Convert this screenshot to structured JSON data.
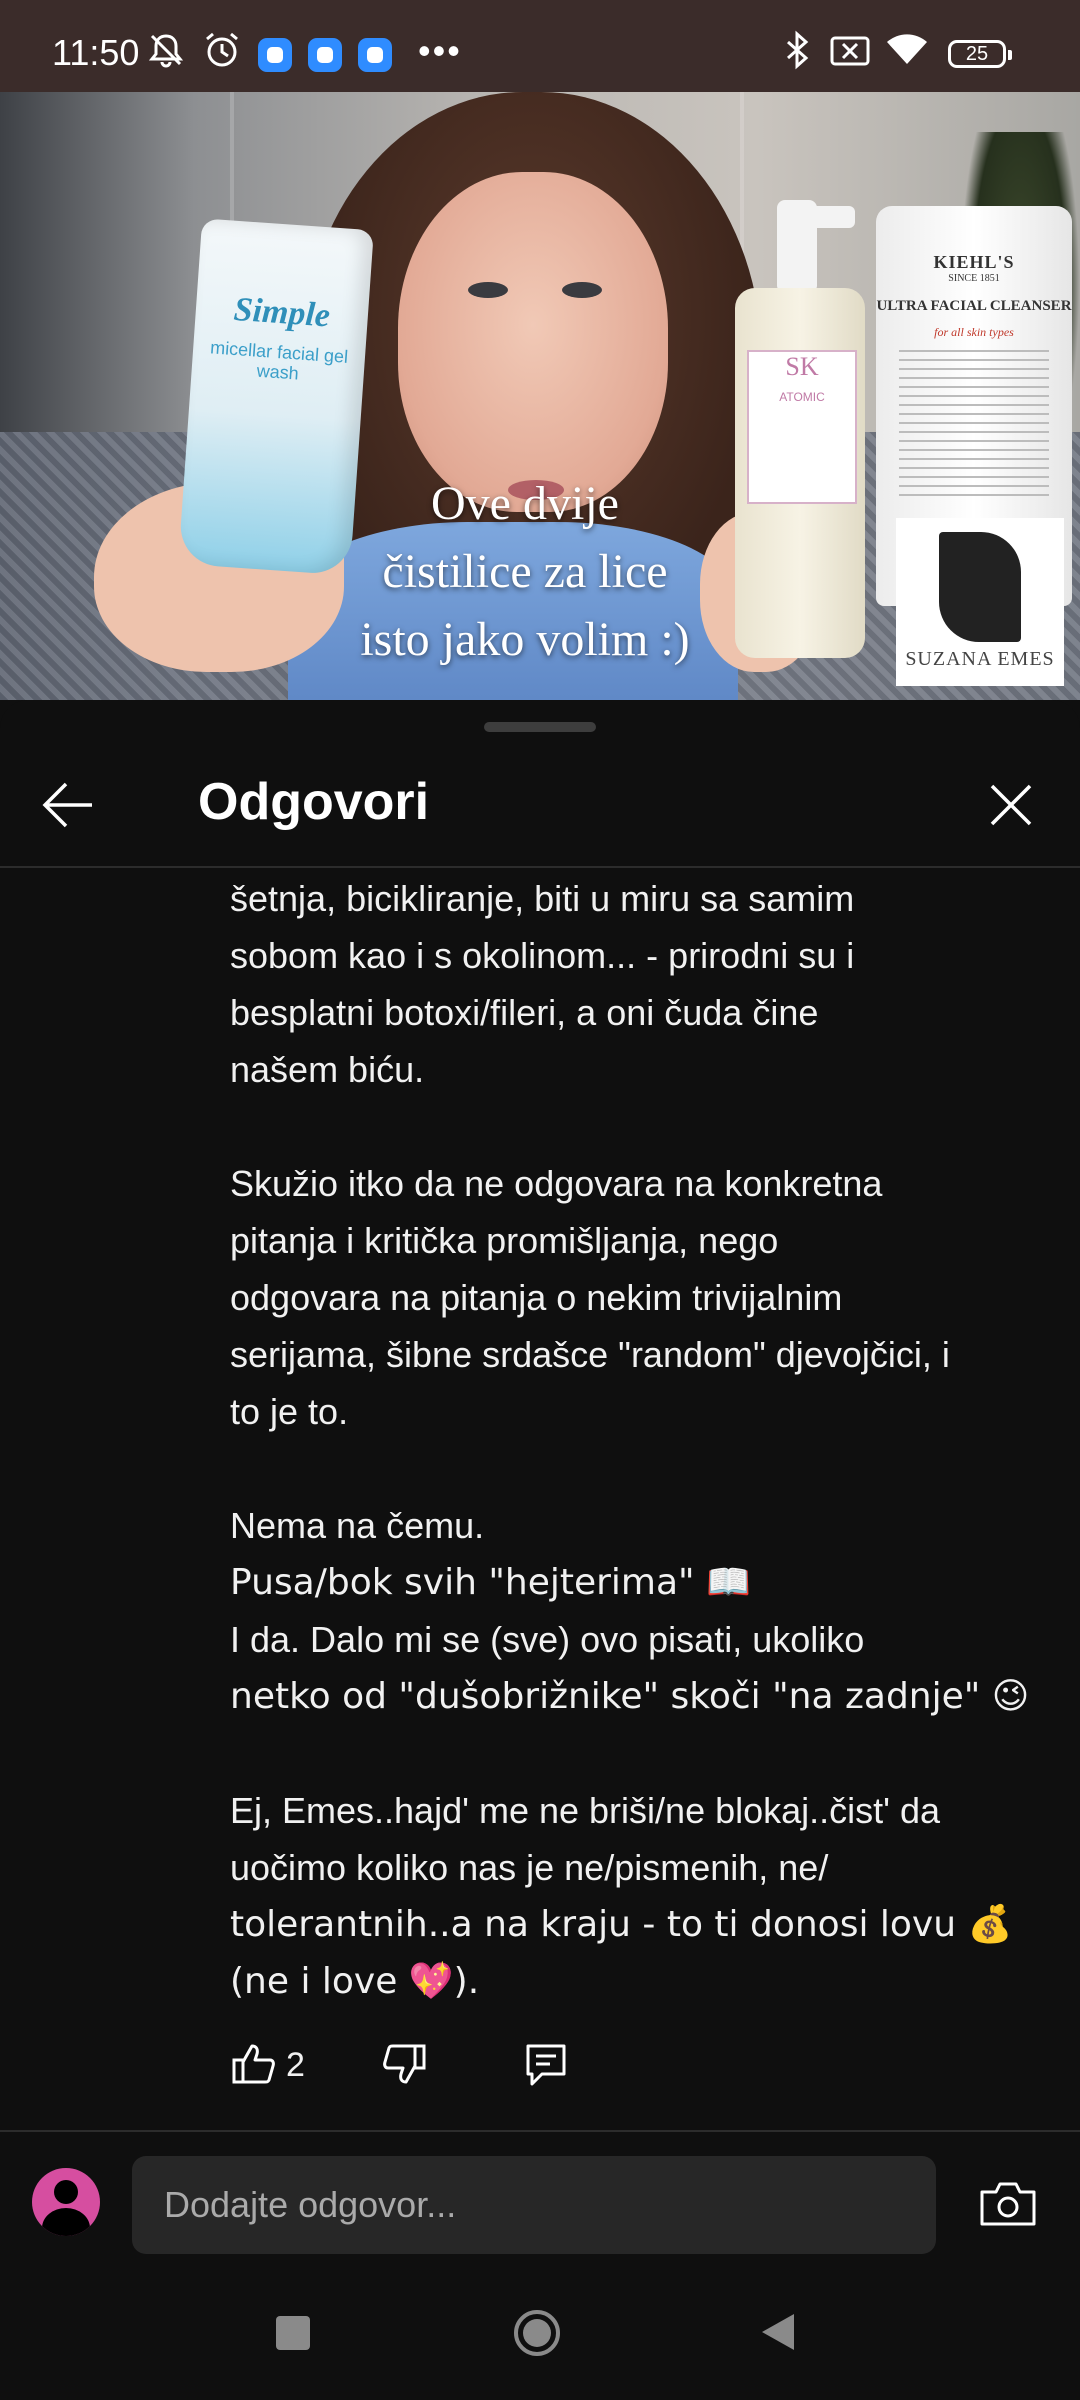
{
  "status_bar": {
    "time": "11:50",
    "battery_level": "25",
    "icons": [
      "silent-bell-icon",
      "alarm-icon",
      "app-notification-icon",
      "app-notification-icon",
      "app-notification-icon",
      "more-icon",
      "bluetooth-icon",
      "no-sim-icon",
      "wifi-icon",
      "battery-icon"
    ]
  },
  "video": {
    "caption": "Ove dvije čistilice za lice isto jako volim :)",
    "caption_lines": [
      "Ove dvije",
      "čistilice za lice",
      "isto jako volim :)"
    ],
    "progress_fraction": 0.075,
    "products": {
      "simple_brand": "Simple",
      "simple_name": "micellar facial gel wash",
      "sk_logo": "SK",
      "sk_name": "ATOMIC",
      "kiehls_brand": "KIEHL'S",
      "kiehls_since": "SINCE 1851",
      "kiehls_product": "ULTRA FACIAL CLEANSER",
      "kiehls_skin": "for all skin types"
    },
    "watermark": "SUZANA EMES",
    "progress_color": "#ff0000"
  },
  "panel": {
    "title": "Odgovori",
    "icons": {
      "back": "back-arrow-icon",
      "close": "close-icon"
    }
  },
  "comment": {
    "paragraphs": [
      [
        "šetnja, bicikliranje, biti u miru sa samim",
        "sobom kao i s okolinom... - prirodni su i",
        "besplatni botoxi/fileri, a oni čuda čine",
        "našem biću."
      ],
      [
        "Skužio itko da ne odgovara na konkretna",
        "pitanja i kritička promišljanja, nego",
        "odgovara na pitanja o nekim trivijalnim",
        "serijama, šibne srdašce \"random\" djevojčici, i",
        "to je to."
      ],
      [
        "Nema na čemu.",
        "Pusa/bok svih \"hejterima\" 📖",
        "I da. Dalo mi se (sve) ovo pisati, ukoliko",
        "netko od \"dušobrižnike\" skoči \"na zadnje\" 😉"
      ],
      [
        "Ej, Emes..hajd' me ne briši/ne blokaj..čist' da",
        "uočimo koliko nas je ne/pismenih, ne/",
        "tolerantnih..a na kraju - to ti donosi lovu 💰",
        "(ne i love 💖)."
      ]
    ],
    "like_count": "2",
    "icons": {
      "like": "thumbs-up-icon",
      "dislike": "thumbs-down-icon",
      "reply": "reply-icon"
    }
  },
  "composer": {
    "placeholder": "Dodajte odgovor...",
    "icons": {
      "avatar": "avatar-icon",
      "camera": "camera-icon"
    },
    "avatar_color": "#d64ea0"
  },
  "nav_bar": {
    "icons": [
      "recent-apps-icon",
      "home-icon",
      "back-icon"
    ]
  },
  "colors": {
    "background": "#0f0f0f",
    "status_bar": "#3b2c2a",
    "input_background": "#272727",
    "text": "#f1f1f1"
  }
}
